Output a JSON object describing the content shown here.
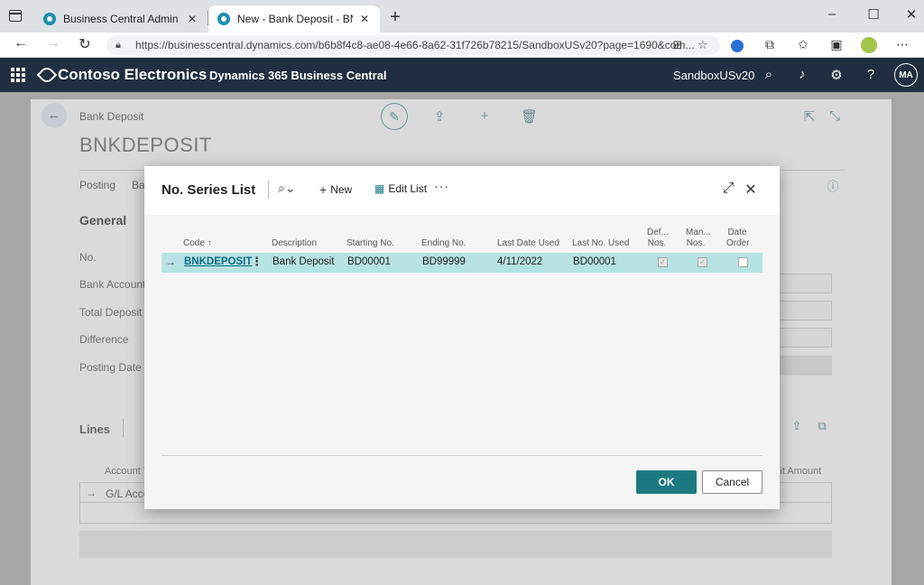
{
  "browser": {
    "tabs": [
      {
        "title": "Business Central Admin Center",
        "active": false
      },
      {
        "title": "New - Bank Deposit - BNKDEPOSIT",
        "active": true
      }
    ],
    "url": "https://businesscentral.dynamics.com/b6b8f4c8-ae08-4e66-8a62-31f726b78215/SandboxUSv20?page=1690&com...",
    "icons": [
      "back-icon",
      "forward-icon",
      "refresh-icon",
      "lock-icon",
      "favorites-icon",
      "collections-icon"
    ]
  },
  "appbar": {
    "company": "Contoso Electronics",
    "product": "Dynamics 365 Business Central",
    "environment": "SandboxUSv20",
    "avatar_initials": "MA"
  },
  "background_page": {
    "caption": "Bank Deposit",
    "title": "BNKDEPOSIT",
    "tabs": [
      "Posting",
      "Ba"
    ],
    "section": "General",
    "fields": [
      "No.",
      "Bank Account",
      "Total Deposit A",
      "Difference",
      "Posting Date"
    ],
    "lines_label": "Lines",
    "lines_columns": [
      "Account Ty",
      "lit Amount"
    ],
    "line_row_value": "G/L Acco"
  },
  "dialog": {
    "title": "No. Series List",
    "new_label": "New",
    "edit_list_label": "Edit List",
    "columns": {
      "code": "Code",
      "description": "Description",
      "starting_no": "Starting No.",
      "ending_no": "Ending No.",
      "last_date_used": "Last Date Used",
      "last_no_used": "Last No. Used",
      "default_nos_1": "Def...",
      "default_nos_2": "Nos.",
      "manual_nos_1": "Man...",
      "manual_nos_2": "Nos.",
      "date_order_1": "Date",
      "date_order_2": "Order"
    },
    "rows": [
      {
        "code": "BNKDEPOSIT",
        "description": "Bank Deposit",
        "starting_no": "BD00001",
        "ending_no": "BD99999",
        "last_date_used": "4/11/2022",
        "last_no_used": "BD00001",
        "default_nos": true,
        "manual_nos": true,
        "date_order": false
      }
    ],
    "ok_label": "OK",
    "cancel_label": "Cancel"
  },
  "colors": {
    "appbar": "#1f2e40",
    "selected_row": "#b7e3e4",
    "primary_button": "#1b7a80",
    "link": "#0b6a83"
  }
}
